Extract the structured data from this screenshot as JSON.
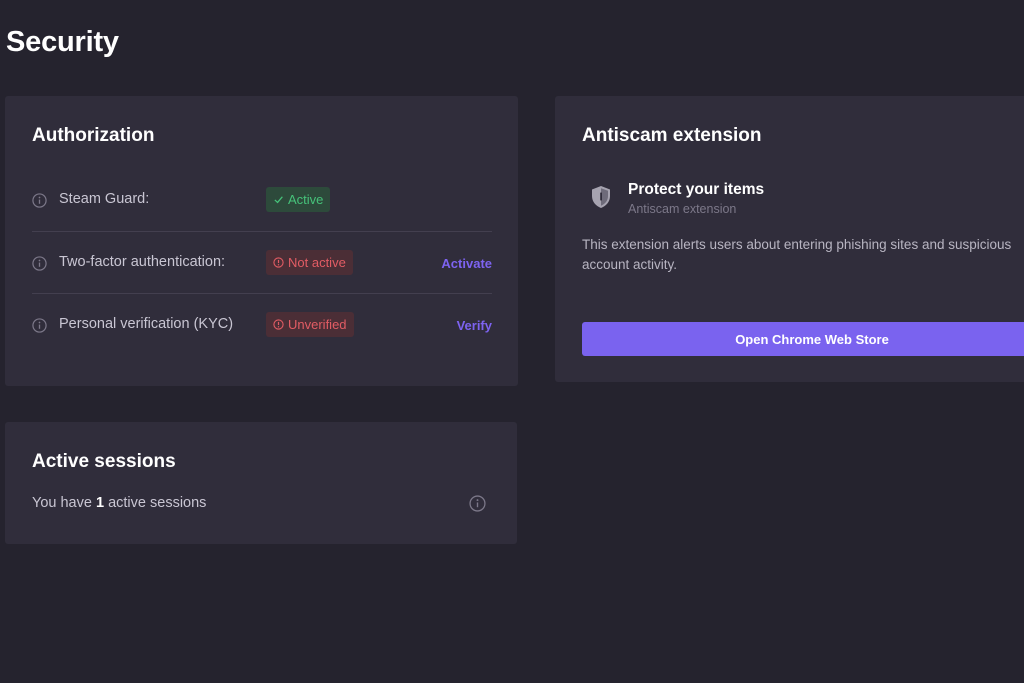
{
  "page": {
    "title": "Security"
  },
  "authorization": {
    "title": "Authorization",
    "rows": [
      {
        "label": "Steam Guard:",
        "status": "Active",
        "status_type": "active",
        "action": ""
      },
      {
        "label": "Two-factor authentication:",
        "status": "Not active",
        "status_type": "inactive",
        "action": "Activate"
      },
      {
        "label": "Personal verification (KYC)",
        "status": "Unverified",
        "status_type": "inactive",
        "action": "Verify"
      }
    ]
  },
  "sessions": {
    "title": "Active sessions",
    "prefix": "You have",
    "count": "1",
    "suffix": "active sessions"
  },
  "antiscam": {
    "title": "Antiscam extension",
    "protect_title": "Protect your items",
    "protect_subtitle": "Antiscam extension",
    "description": "This extension alerts users about entering phishing sites and suspicious account activity.",
    "button_label": "Open Chrome Web Store"
  },
  "colors": {
    "background": "#25232e",
    "card": "#302d3b",
    "accent": "#7a63ef",
    "success": "#46c27a",
    "danger": "#e25c64"
  },
  "icons": [
    "info-icon",
    "check-icon",
    "alert-icon",
    "shield-icon"
  ]
}
